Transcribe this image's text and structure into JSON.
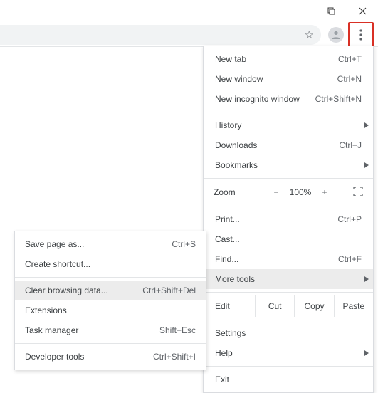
{
  "windowControls": {
    "min": "minimize",
    "max": "maximize",
    "close": "close"
  },
  "mainMenu": {
    "newTab": {
      "label": "New tab",
      "shortcut": "Ctrl+T"
    },
    "newWindow": {
      "label": "New window",
      "shortcut": "Ctrl+N"
    },
    "incognito": {
      "label": "New incognito window",
      "shortcut": "Ctrl+Shift+N"
    },
    "history": {
      "label": "History"
    },
    "downloads": {
      "label": "Downloads",
      "shortcut": "Ctrl+J"
    },
    "bookmarks": {
      "label": "Bookmarks"
    },
    "zoom": {
      "label": "Zoom",
      "minus": "−",
      "value": "100%",
      "plus": "+"
    },
    "print": {
      "label": "Print...",
      "shortcut": "Ctrl+P"
    },
    "cast": {
      "label": "Cast..."
    },
    "find": {
      "label": "Find...",
      "shortcut": "Ctrl+F"
    },
    "moreTools": {
      "label": "More tools"
    },
    "edit": {
      "label": "Edit",
      "cut": "Cut",
      "copy": "Copy",
      "paste": "Paste"
    },
    "settings": {
      "label": "Settings"
    },
    "help": {
      "label": "Help"
    },
    "exit": {
      "label": "Exit"
    }
  },
  "subMenu": {
    "savePage": {
      "label": "Save page as...",
      "shortcut": "Ctrl+S"
    },
    "shortcut": {
      "label": "Create shortcut..."
    },
    "clearData": {
      "label": "Clear browsing data...",
      "shortcut": "Ctrl+Shift+Del"
    },
    "extensions": {
      "label": "Extensions"
    },
    "taskMgr": {
      "label": "Task manager",
      "shortcut": "Shift+Esc"
    },
    "devTools": {
      "label": "Developer tools",
      "shortcut": "Ctrl+Shift+I"
    }
  }
}
